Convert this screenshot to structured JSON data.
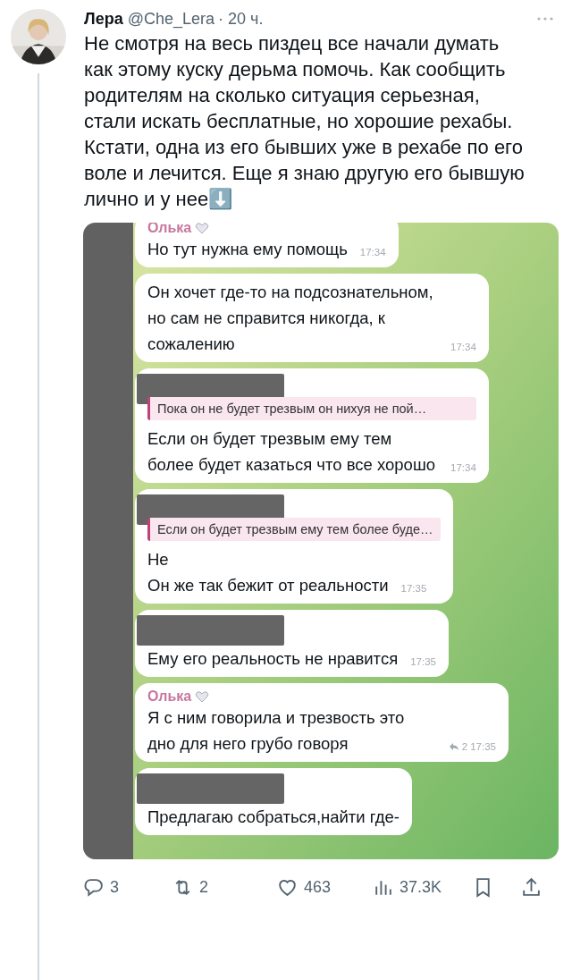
{
  "tweet": {
    "author": "Лера",
    "handle": "@Che_Lera",
    "time": "· 20 ч.",
    "text": "Не смотря на весь пиздец все начали думать как этому куску дерьма помочь. Как сообщить родителям на сколько ситуация серьезная, стали искать бесплатные, но хорошие рехабы.\nКстати, одна из его бывших уже в рехабе по его воле и лечится. Еще я знаю другую его бывшую лично и у нее⬇️"
  },
  "chat": {
    "messages": [
      {
        "sender": "Олька",
        "redacted": false,
        "text": "Но тут нужна ему помощь",
        "time": "17:34"
      },
      {
        "redacted": false,
        "text": "Он хочет где-то на подсознательном, но сам не справится никогда, к сожалению",
        "time": "17:34"
      },
      {
        "redacted": true,
        "quote": "Пока он не будет трезвым он нихуя не пой…",
        "text": "Если он будет трезвым ему тем более будет казаться что все хорошо",
        "time": "17:34"
      },
      {
        "redacted": true,
        "quote": "Если он будет трезвым ему тем более буде…",
        "text": "Не\nОн же так бежит от реальности",
        "time": "17:35"
      },
      {
        "redacted": true,
        "text": "Ему его реальность не нравится",
        "time": "17:35"
      },
      {
        "sender": "Олька",
        "redacted": false,
        "text": "Я с ним говорила и трезвость это дно для него грубо говоря",
        "replies": "2",
        "time": "17:35"
      },
      {
        "redacted": true,
        "text": "Предлагаю собраться,найти где-"
      }
    ]
  },
  "actions": [
    {
      "kind": "reply",
      "count": "3"
    },
    {
      "kind": "retweet",
      "count": "2"
    },
    {
      "kind": "like",
      "count": "463"
    },
    {
      "kind": "views",
      "count": "37.3K"
    },
    {
      "kind": "bookmark"
    },
    {
      "kind": "share"
    }
  ]
}
